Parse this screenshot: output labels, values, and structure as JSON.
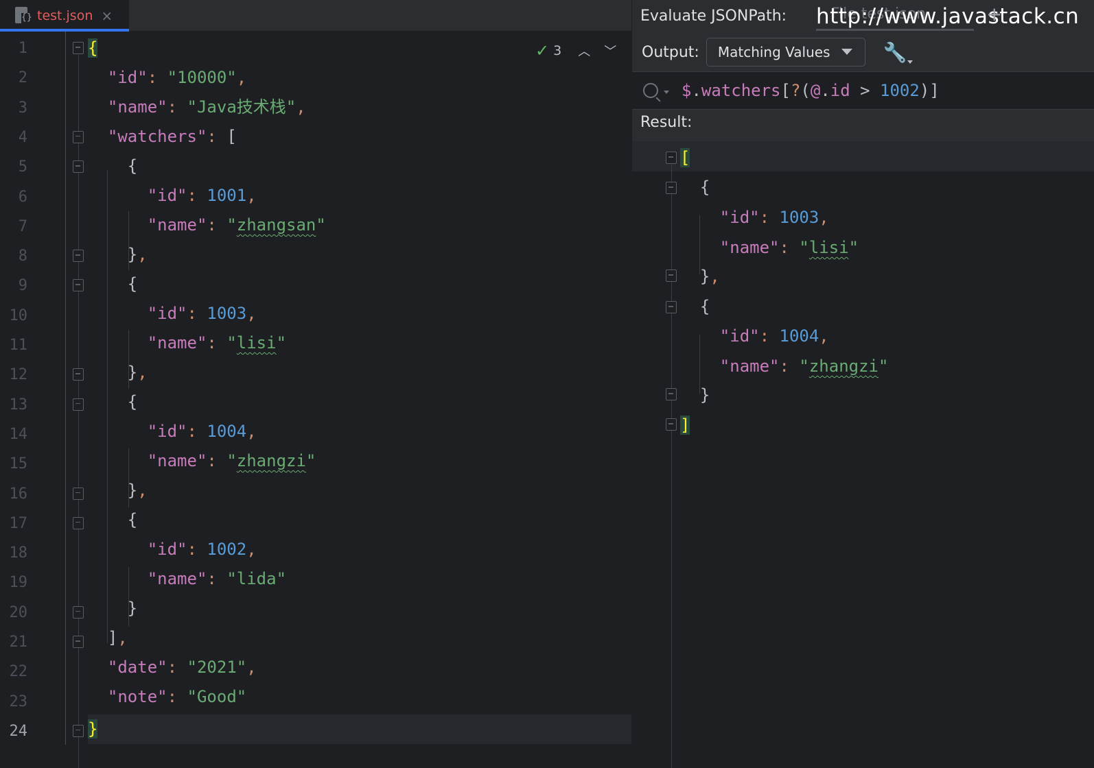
{
  "editor": {
    "tab": {
      "label": "test.json",
      "close": "×"
    },
    "inspections": {
      "count": "3"
    },
    "lines": [
      {
        "n": "1"
      },
      {
        "n": "2"
      },
      {
        "n": "3"
      },
      {
        "n": "4"
      },
      {
        "n": "5"
      },
      {
        "n": "6"
      },
      {
        "n": "7"
      },
      {
        "n": "8"
      },
      {
        "n": "9"
      },
      {
        "n": "10"
      },
      {
        "n": "11"
      },
      {
        "n": "12"
      },
      {
        "n": "13"
      },
      {
        "n": "14"
      },
      {
        "n": "15"
      },
      {
        "n": "16"
      },
      {
        "n": "17"
      },
      {
        "n": "18"
      },
      {
        "n": "19"
      },
      {
        "n": "20"
      },
      {
        "n": "21"
      },
      {
        "n": "22"
      },
      {
        "n": "23"
      },
      {
        "n": "24"
      }
    ],
    "code": {
      "id_key": "\"id\"",
      "id_val": "\"10000\"",
      "name_key": "\"name\"",
      "name_val": "\"Java技术栈\"",
      "watchers_key": "\"watchers\"",
      "w": [
        {
          "id": "1001",
          "name": "zhangsan"
        },
        {
          "id": "1003",
          "name": "lisi"
        },
        {
          "id": "1004",
          "name": "zhangzi"
        },
        {
          "id": "1002",
          "name": "lida"
        }
      ],
      "date_key": "\"date\"",
      "date_val": "\"2021\"",
      "note_key": "\"note\"",
      "note_val": "\"Good\""
    }
  },
  "panel": {
    "title": "Evaluate JSONPath:",
    "tab_label": "File test.json",
    "watermark": "http://www.javastack.cn",
    "plus": "+",
    "output_label": "Output:",
    "output_value": "Matching Values",
    "query": {
      "dollar": "$",
      "dot1": ".",
      "prop": "watchers",
      "open": "[",
      "q": "?",
      "paren_open": "(",
      "at": "@",
      "dot2": ".",
      "field": "id",
      "op": " > ",
      "num": "1002",
      "close": ")]"
    },
    "result_label": "Result:",
    "result": [
      {
        "id": "1003",
        "name": "lisi"
      },
      {
        "id": "1004",
        "name": "zhangzi"
      }
    ]
  },
  "colors": {
    "key": "#c77dbb",
    "string": "#6aab73",
    "number": "#5a9bd5",
    "accent": "#3574f0",
    "brace_highlight": "#ffef28"
  }
}
